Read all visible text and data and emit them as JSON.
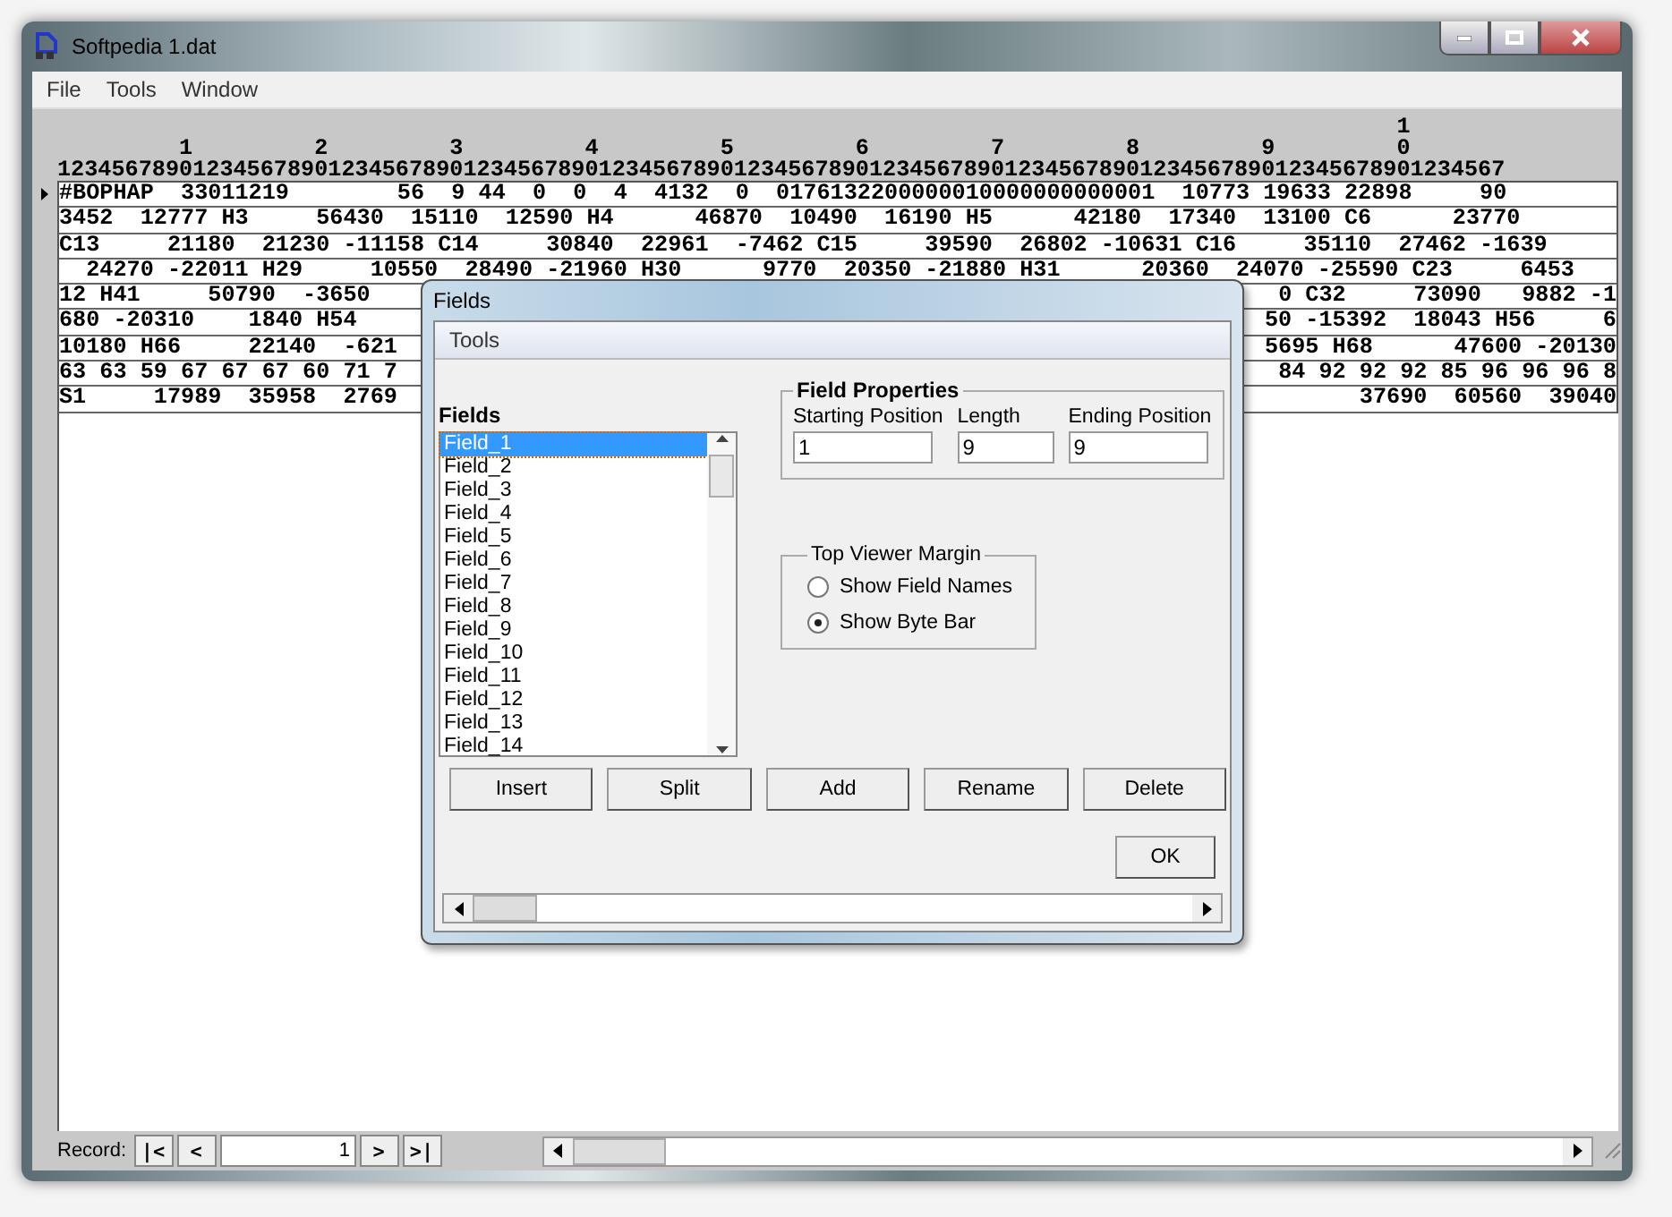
{
  "window": {
    "title": "Softpedia 1.dat"
  },
  "menu": [
    "File",
    "Tools",
    "Window"
  ],
  "ruler": {
    "hundreds": "                                                                                                   1",
    "tens": "         1         2         3         4         5         6         7         8         9         0",
    "units": "12345678901234567890123456789012345678901234567890123456789012345678901234567890123456789012345678901234567"
  },
  "rows": [
    {
      "text": "#BOPHAP  33011219        56  9 44  0  0  4  4132  0  0176132200000010000000000001  10773 19633 22898     90",
      "current": true
    },
    {
      "text": "3452  12777 H3     56430  15110  12590 H4      46870  10490  16190 H5      42180  17340  13100 C6      23770",
      "current": false
    },
    {
      "text": "C13     21180  21230 -11158 C14     30840  22961  -7462 C15     39590  26802 -10631 C16     35110  27462 -1639",
      "current": false
    },
    {
      "text": "  24270 -22011 H29     10550  28490 -21960 H30      9770  20350 -21880 H31      20360  24070 -25590 C23     6453",
      "current": false
    },
    {
      "left": "12 H41     50790  -3650",
      "right": "0 C32     73090   9882 -1",
      "current": false
    },
    {
      "left": "680 -20310    1840 H54",
      "right": "50 -15392  18043 H56     6",
      "current": false
    },
    {
      "left": "10180 H66     22140  -621",
      "right": "5695 H68      47600 -20130",
      "current": false
    },
    {
      "left": "63 63 59 67 67 67 60 71 7",
      "right": "84 92 92 92 85 96 96 96 8",
      "current": false
    },
    {
      "left": "S1     17989  35958  2769",
      "right": "37690  60560  39040",
      "current": false
    }
  ],
  "record_bar": {
    "label": "Record:",
    "first": "|<",
    "prev": "<",
    "value": "1",
    "next": ">",
    "last": ">|"
  },
  "dialog": {
    "title": "Fields",
    "menu": [
      "Tools"
    ],
    "list_label": "Fields",
    "fields": [
      {
        "name": "Field_1",
        "selected": true
      },
      {
        "name": "Field_2",
        "selected": false
      },
      {
        "name": "Field_3",
        "selected": false
      },
      {
        "name": "Field_4",
        "selected": false
      },
      {
        "name": "Field_5",
        "selected": false
      },
      {
        "name": "Field_6",
        "selected": false
      },
      {
        "name": "Field_7",
        "selected": false
      },
      {
        "name": "Field_8",
        "selected": false
      },
      {
        "name": "Field_9",
        "selected": false
      },
      {
        "name": "Field_10",
        "selected": false
      },
      {
        "name": "Field_11",
        "selected": false
      },
      {
        "name": "Field_12",
        "selected": false
      },
      {
        "name": "Field_13",
        "selected": false
      },
      {
        "name": "Field_14",
        "selected": false
      }
    ],
    "properties": {
      "title": "Field Properties",
      "inputs": [
        {
          "label": "Starting Position",
          "value": "1"
        },
        {
          "label": "Length",
          "value": "9"
        },
        {
          "label": "Ending Position",
          "value": "9"
        }
      ]
    },
    "margin": {
      "title": "Top Viewer Margin",
      "options": [
        {
          "label": "Show Field Names",
          "selected": false
        },
        {
          "label": "Show Byte Bar",
          "selected": true
        }
      ]
    },
    "buttons": [
      "Insert",
      "Split",
      "Add",
      "Rename",
      "Delete"
    ],
    "ok": "OK"
  }
}
